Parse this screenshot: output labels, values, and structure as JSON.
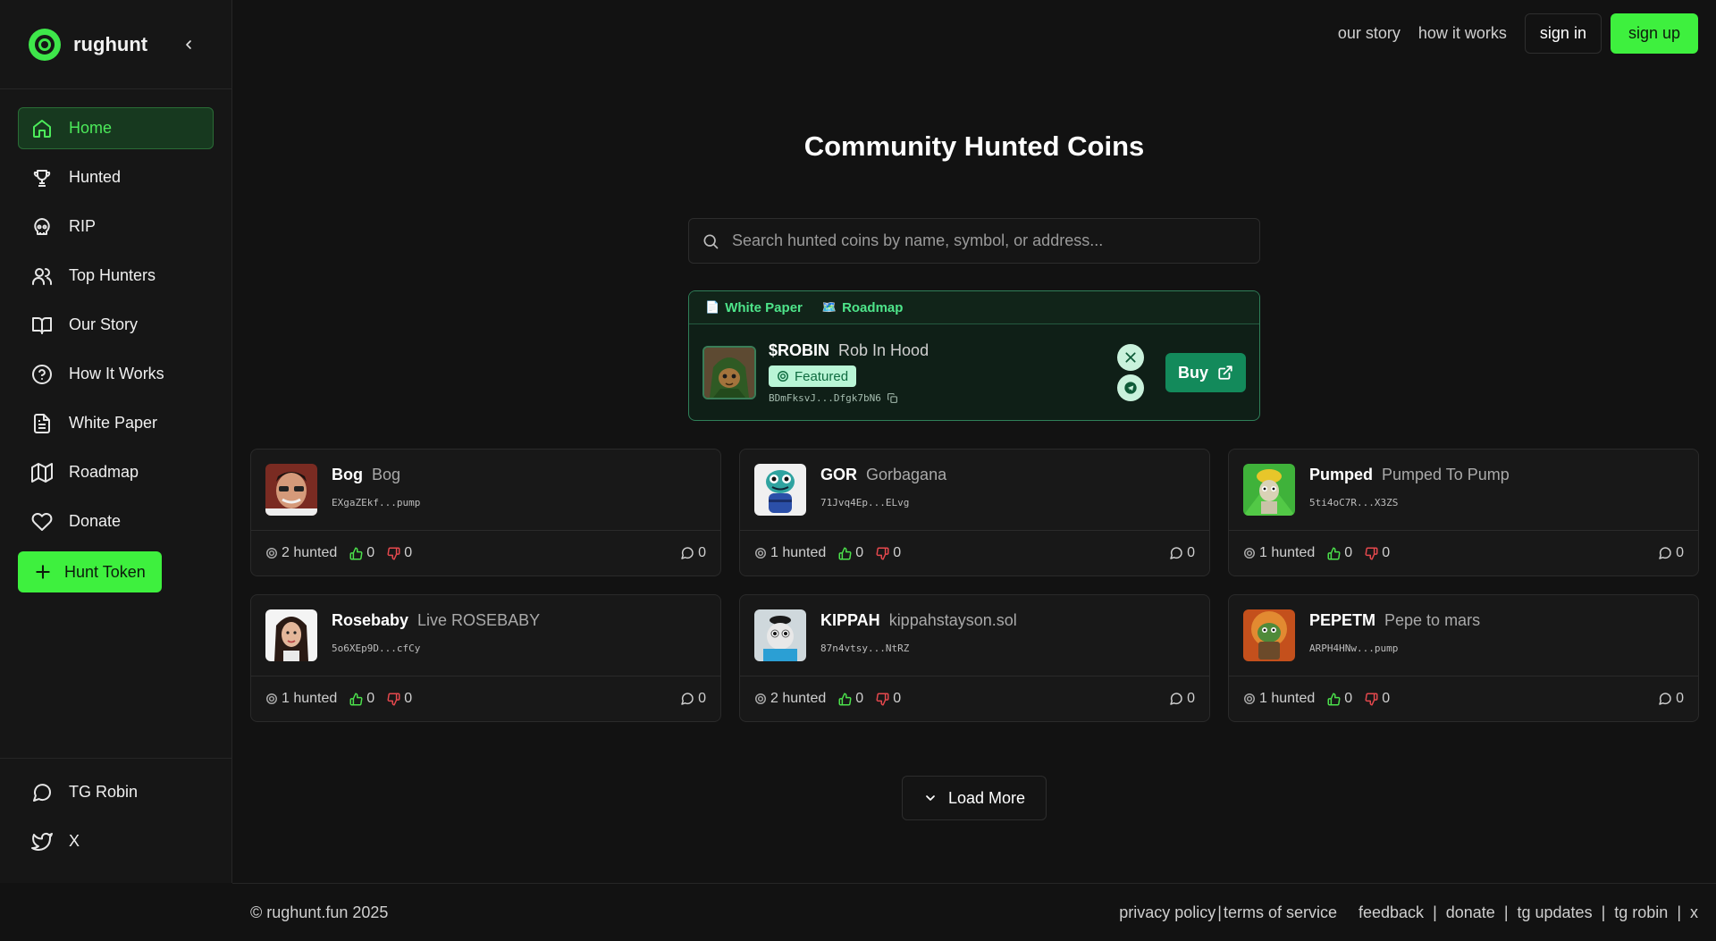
{
  "brand": {
    "name": "rughunt"
  },
  "sidebar": {
    "items": [
      {
        "label": "Home",
        "icon": "home-icon"
      },
      {
        "label": "Hunted",
        "icon": "trophy-icon"
      },
      {
        "label": "RIP",
        "icon": "skull-icon"
      },
      {
        "label": "Top Hunters",
        "icon": "users-icon"
      },
      {
        "label": "Our Story",
        "icon": "book-icon"
      },
      {
        "label": "How It Works",
        "icon": "help-circle-icon"
      },
      {
        "label": "White Paper",
        "icon": "document-icon"
      },
      {
        "label": "Roadmap",
        "icon": "map-icon"
      },
      {
        "label": "Donate",
        "icon": "heart-icon"
      }
    ],
    "hunt_button": "Hunt Token",
    "bottom": [
      {
        "label": "TG Robin",
        "icon": "chat-icon"
      },
      {
        "label": "X",
        "icon": "twitter-icon"
      }
    ]
  },
  "topnav": {
    "our_story": "our story",
    "how_it_works": "how it works",
    "sign_in": "sign in",
    "sign_up": "sign up"
  },
  "main": {
    "title": "Community Hunted Coins",
    "search_placeholder": "Search hunted coins by name, symbol, or address..."
  },
  "featured": {
    "white_paper": "White Paper",
    "roadmap": "Roadmap",
    "symbol": "$ROBIN",
    "name": "Rob In Hood",
    "badge": "Featured",
    "address": "BDmFksvJ...Dfgk7bN6",
    "buy": "Buy"
  },
  "coins": [
    {
      "symbol": "Bog",
      "name": "Bog",
      "address": "EXgaZEkf...pump",
      "hunted": "2 hunted",
      "up": "0",
      "down": "0",
      "comments": "0"
    },
    {
      "symbol": "GOR",
      "name": "Gorbagana",
      "address": "71Jvq4Ep...ELvg",
      "hunted": "1 hunted",
      "up": "0",
      "down": "0",
      "comments": "0"
    },
    {
      "symbol": "Pumped",
      "name": "Pumped To Pump",
      "address": "5ti4oC7R...X3ZS",
      "hunted": "1 hunted",
      "up": "0",
      "down": "0",
      "comments": "0"
    },
    {
      "symbol": "Rosebaby",
      "name": "Live ROSEBABY",
      "address": "5o6XEp9D...cfCy",
      "hunted": "1 hunted",
      "up": "0",
      "down": "0",
      "comments": "0"
    },
    {
      "symbol": "KIPPAH",
      "name": "kippahstayson.sol",
      "address": "87n4vtsy...NtRZ",
      "hunted": "2 hunted",
      "up": "0",
      "down": "0",
      "comments": "0"
    },
    {
      "symbol": "PEPETM",
      "name": "Pepe to mars",
      "address": "ARPH4HNw...pump",
      "hunted": "1 hunted",
      "up": "0",
      "down": "0",
      "comments": "0"
    }
  ],
  "load_more": "Load More",
  "footer": {
    "copyright": "© rughunt.fun 2025",
    "privacy": "privacy policy",
    "terms": "terms of service",
    "feedback": "feedback",
    "donate": "donate",
    "tg_updates": "tg updates",
    "tg_robin": "tg robin",
    "x": "x"
  },
  "colors": {
    "accent": "#3ef03e",
    "featured_green": "#138a5b",
    "upvote": "#4be04b",
    "downvote": "#e5484d"
  }
}
